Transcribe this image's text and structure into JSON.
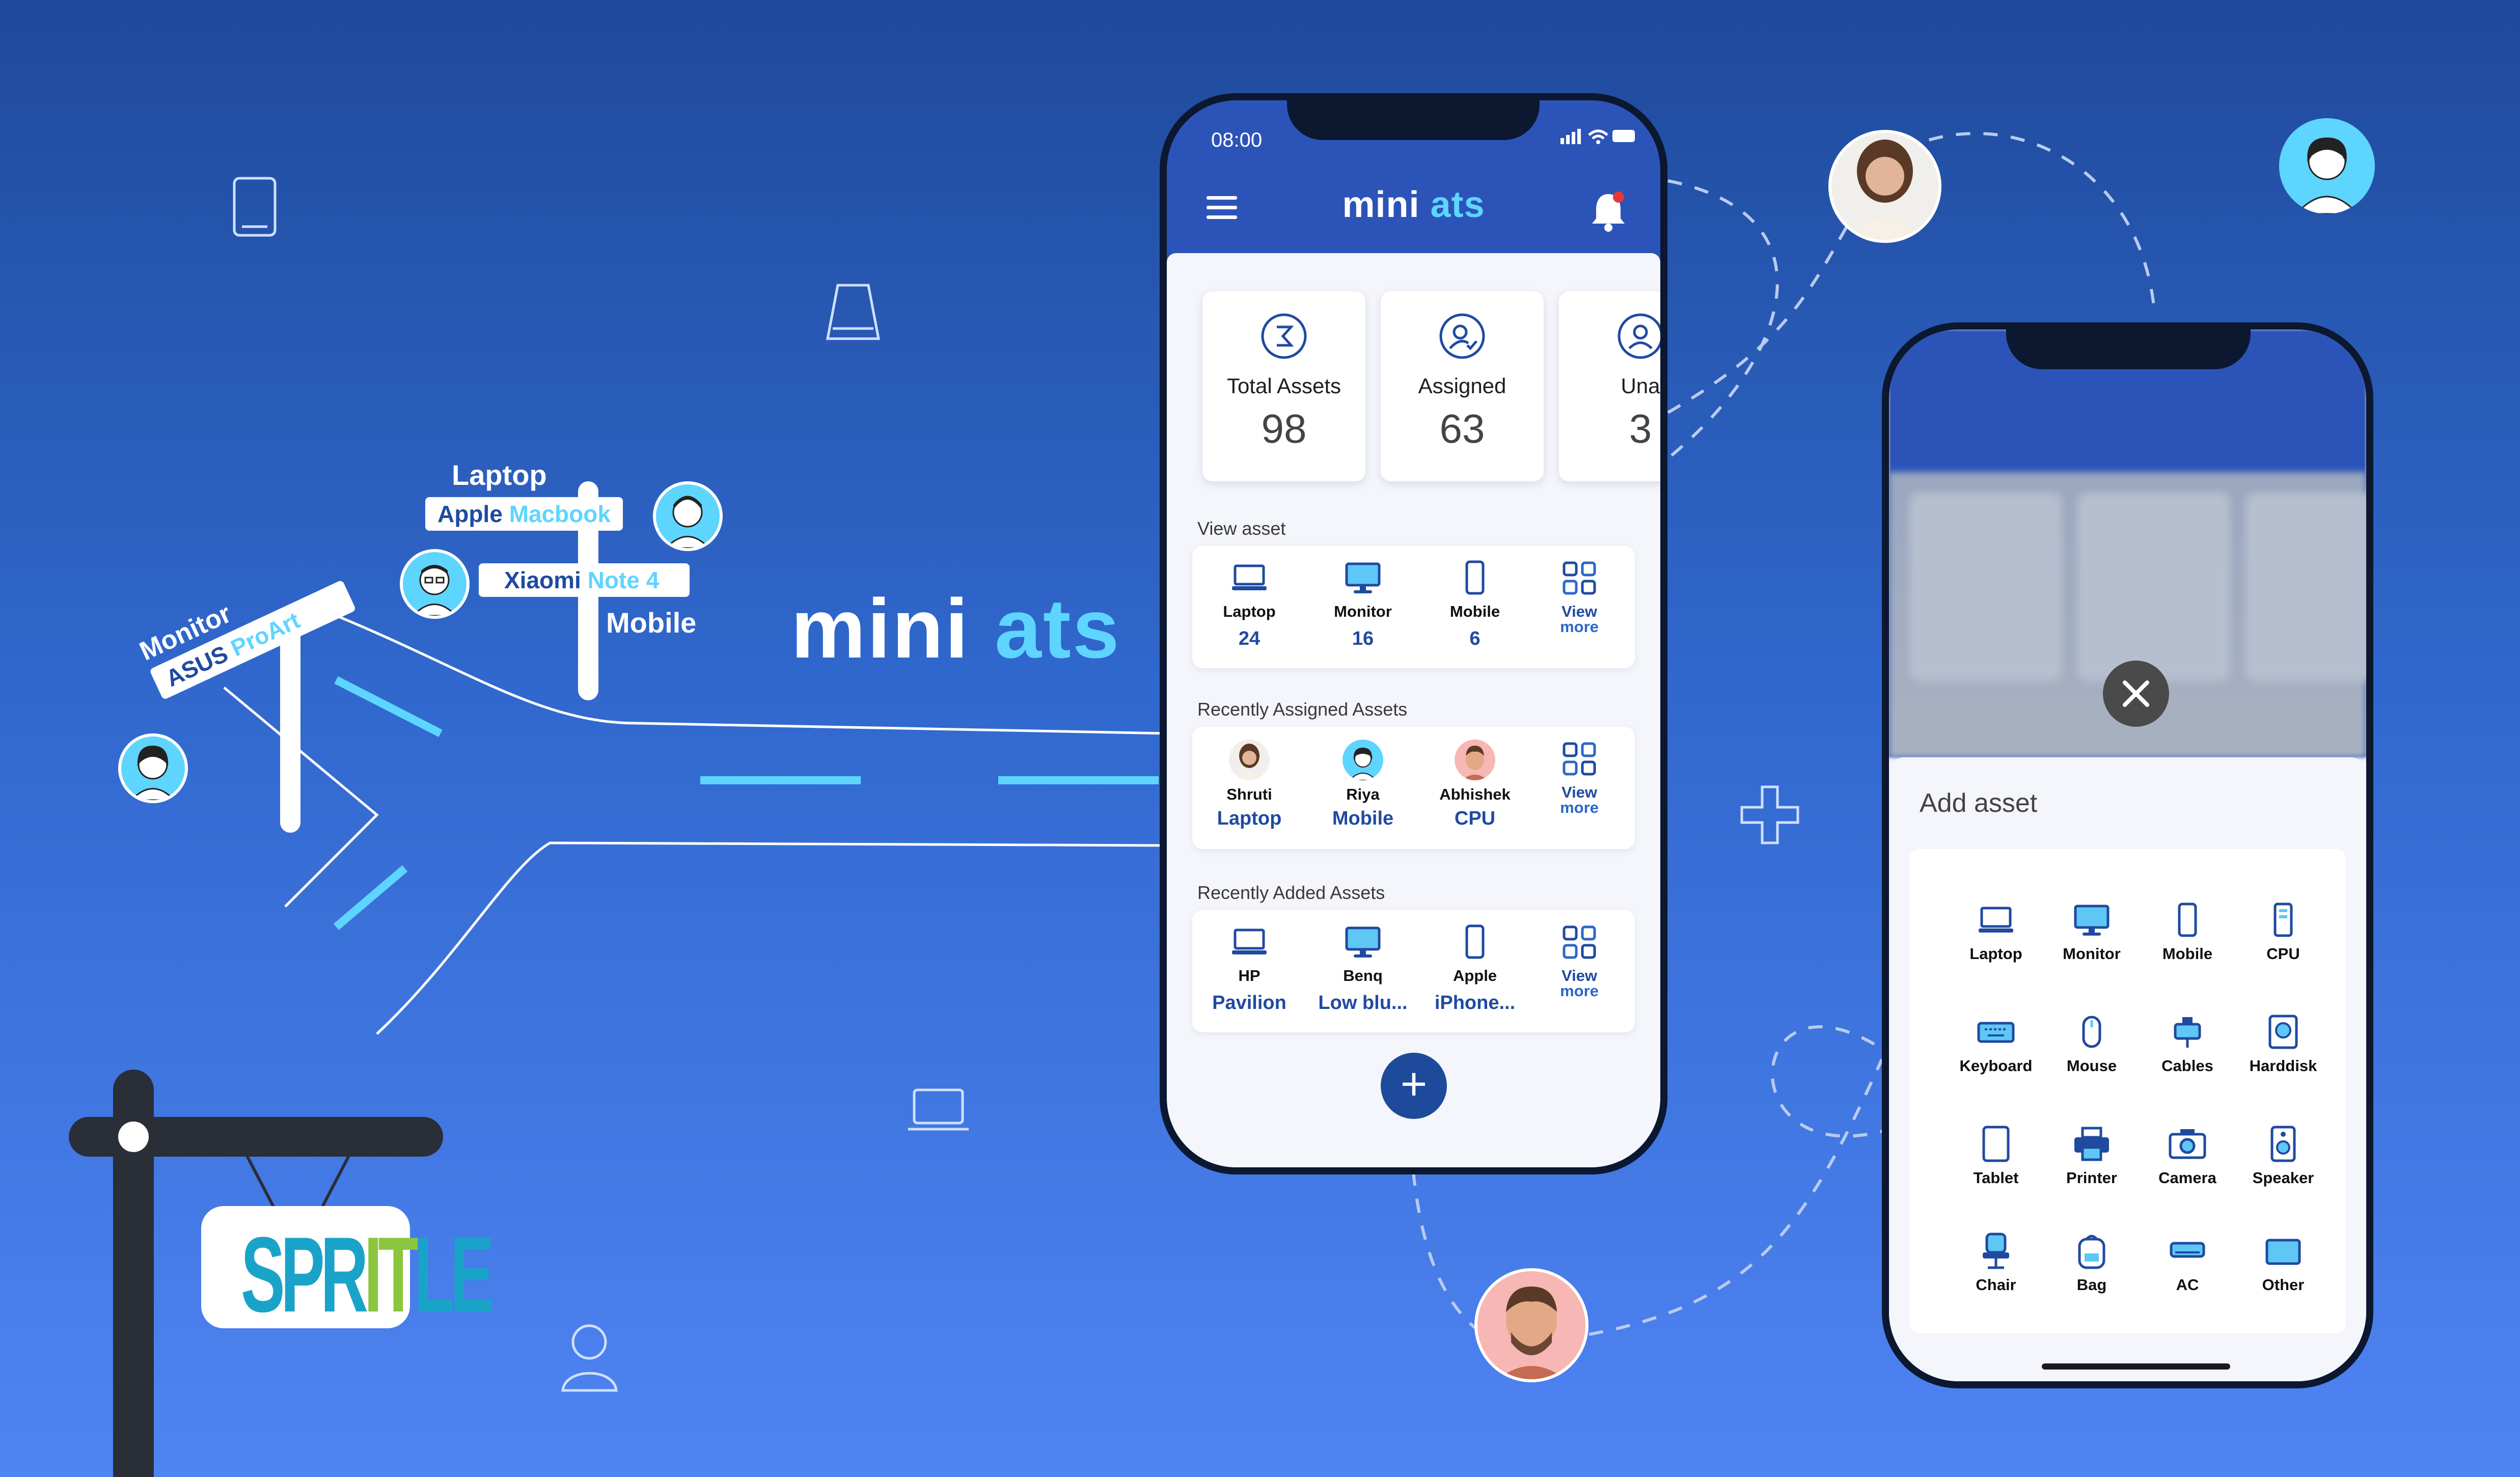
{
  "brand": {
    "name": "mini",
    "accent": "ats"
  },
  "signpost": {
    "laptop_label": "Laptop",
    "laptop_sign_a": "Apple",
    "laptop_sign_b": "Macbook",
    "mobile_sign_a": "Xiaomi",
    "mobile_sign_b": "Note 4",
    "mobile_label": "Mobile",
    "monitor_label": "Monitor",
    "monitor_sign_a": "ASUS",
    "monitor_sign_b": "ProArt"
  },
  "company_logo": {
    "letters": [
      "SPR",
      "IT",
      "LE"
    ]
  },
  "phone_main": {
    "time": "08:00",
    "app_title": "mini",
    "app_title_accent": "ats",
    "stats": [
      {
        "label": "Total Assets",
        "value": "98",
        "icon": "sigma-icon"
      },
      {
        "label": "Assigned",
        "value": "63",
        "icon": "user-check-icon"
      },
      {
        "label": "Una",
        "value": "3",
        "icon": "user-icon"
      }
    ],
    "view_asset": {
      "title": "View asset",
      "items": [
        {
          "name": "Laptop",
          "value": "24",
          "icon": "laptop-icon"
        },
        {
          "name": "Monitor",
          "value": "16",
          "icon": "monitor-icon"
        },
        {
          "name": "Mobile",
          "value": "6",
          "icon": "mobile-icon"
        }
      ],
      "more_a": "View",
      "more_b": "more"
    },
    "recently_assigned": {
      "title": "Recently Assigned Assets",
      "items": [
        {
          "name": "Shruti",
          "value": "Laptop"
        },
        {
          "name": "Riya",
          "value": "Mobile"
        },
        {
          "name": "Abhishek",
          "value": "CPU"
        }
      ],
      "more_a": "View",
      "more_b": "more"
    },
    "recently_added": {
      "title": "Recently Added Assets",
      "items": [
        {
          "name": "HP",
          "value": "Pavilion",
          "icon": "laptop-icon"
        },
        {
          "name": "Benq",
          "value": "Low blu...",
          "icon": "monitor-icon"
        },
        {
          "name": "Apple",
          "value": "iPhone...",
          "icon": "mobile-icon"
        }
      ],
      "more_a": "View",
      "more_b": "more"
    },
    "fab": "+"
  },
  "phone_add": {
    "sheet_title": "Add asset",
    "assets": [
      {
        "name": "Laptop",
        "icon": "laptop-icon"
      },
      {
        "name": "Monitor",
        "icon": "monitor-icon"
      },
      {
        "name": "Mobile",
        "icon": "mobile-icon"
      },
      {
        "name": "CPU",
        "icon": "cpu-icon"
      },
      {
        "name": "Keyboard",
        "icon": "keyboard-icon"
      },
      {
        "name": "Mouse",
        "icon": "mouse-icon"
      },
      {
        "name": "Cables",
        "icon": "cables-icon"
      },
      {
        "name": "Harddisk",
        "icon": "harddisk-icon"
      },
      {
        "name": "Tablet",
        "icon": "tablet-icon"
      },
      {
        "name": "Printer",
        "icon": "printer-icon"
      },
      {
        "name": "Camera",
        "icon": "camera-icon"
      },
      {
        "name": "Speaker",
        "icon": "speaker-icon"
      },
      {
        "name": "Chair",
        "icon": "chair-icon"
      },
      {
        "name": "Bag",
        "icon": "bag-icon"
      },
      {
        "name": "AC",
        "icon": "ac-icon"
      },
      {
        "name": "Other",
        "icon": "other-icon"
      }
    ]
  },
  "colors": {
    "accent": "#5ed5ff",
    "primary": "#1f4aa0",
    "bg_top": "#1f4a9b",
    "bg_bottom": "#4f84f3"
  }
}
